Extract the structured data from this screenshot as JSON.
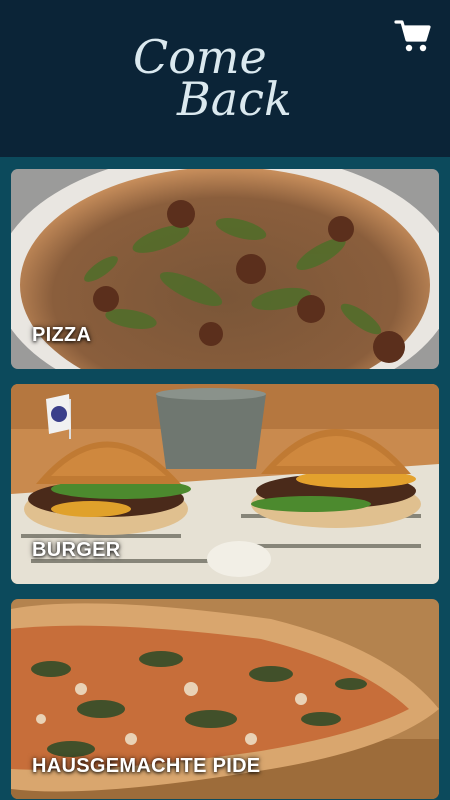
{
  "header": {
    "logo_line1": "Come",
    "logo_line2": "Back",
    "cart_icon": "shopping-cart-icon"
  },
  "colors": {
    "header_bg": "#0b2437",
    "content_bg": "#0c4a5c",
    "logo_text": "#dbe9ef",
    "label_text": "#ffffff"
  },
  "categories": [
    {
      "label": "PIZZA",
      "image": "pizza-photo"
    },
    {
      "label": "BURGER",
      "image": "burger-photo"
    },
    {
      "label": "HAUSGEMACHTE PIDE",
      "image": "pide-photo"
    }
  ]
}
